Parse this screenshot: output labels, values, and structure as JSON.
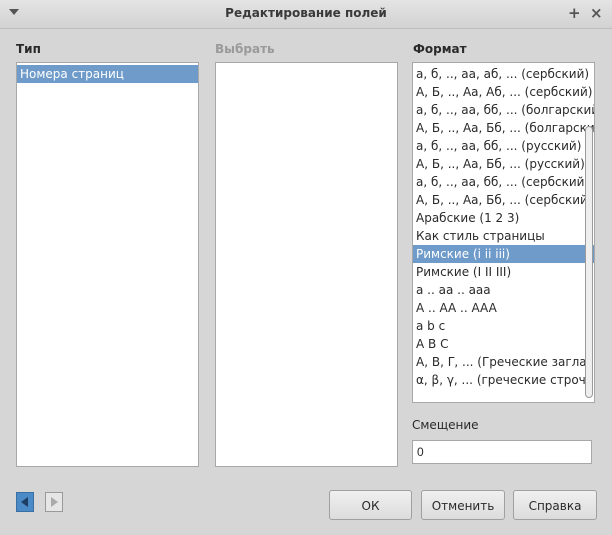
{
  "window": {
    "title": "Редактирование полей"
  },
  "type_column": {
    "label": "Тип",
    "items": [
      {
        "label": "Номера страниц",
        "selected": true
      }
    ]
  },
  "select_column": {
    "label": "Выбрать",
    "items": []
  },
  "format_column": {
    "label": "Формат",
    "items": [
      {
        "label": "а, б, .., аа, аб, ... (сербский)",
        "selected": false
      },
      {
        "label": "А, Б, .., Аа, Аб, ... (сербский)",
        "selected": false
      },
      {
        "label": "а, б, .., аа, бб, ... (болгарский)",
        "selected": false
      },
      {
        "label": "А, Б, .., Аа, Бб, ... (болгарский)",
        "selected": false
      },
      {
        "label": "а, б, .., аа, бб, ... (русский)",
        "selected": false
      },
      {
        "label": "А, Б, .., Аа, Бб, ... (русский)",
        "selected": false
      },
      {
        "label": "а, б, .., аа, бб, ... (сербский)",
        "selected": false
      },
      {
        "label": "А, Б, .., Аа, Бб, ... (сербский)",
        "selected": false
      },
      {
        "label": "Арабские (1 2 3)",
        "selected": false
      },
      {
        "label": "Как стиль страницы",
        "selected": false
      },
      {
        "label": "Римские (i ii iii)",
        "selected": true
      },
      {
        "label": "Римские (I II III)",
        "selected": false
      },
      {
        "label": "a .. aa .. aaa",
        "selected": false
      },
      {
        "label": "A .. AA .. AAA",
        "selected": false
      },
      {
        "label": "a b c",
        "selected": false
      },
      {
        "label": "A B C",
        "selected": false
      },
      {
        "label": "Α, Β, Γ, ... (Греческие заглавные)",
        "selected": false
      },
      {
        "label": "α, β, γ, ... (греческие строчные)",
        "selected": false
      }
    ]
  },
  "offset": {
    "label": "Смещение",
    "value": "0"
  },
  "buttons": {
    "ok": "ОК",
    "cancel": "Отменить",
    "help": "Справка"
  },
  "colors": {
    "selection": "#6e9bc9",
    "nav_active": "#4a8ac6"
  }
}
